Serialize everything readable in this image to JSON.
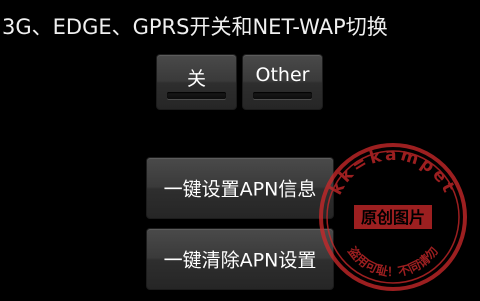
{
  "header": {
    "title": "3G、EDGE、GPRS开关和NET-WAP切换"
  },
  "toggles": [
    {
      "label": "关"
    },
    {
      "label": "Other"
    }
  ],
  "actions": [
    {
      "label": "一键设置APN信息"
    },
    {
      "label": "一键清除APN设置"
    }
  ],
  "watermark": {
    "top_text": "kk=kampet",
    "center_text": "原创图片",
    "bottom_text": "盗用可耻！不同请勿",
    "color": "#c8282a"
  },
  "colors": {
    "background": "#000000",
    "button": "#3a3a3a",
    "text": "#ffffff"
  }
}
